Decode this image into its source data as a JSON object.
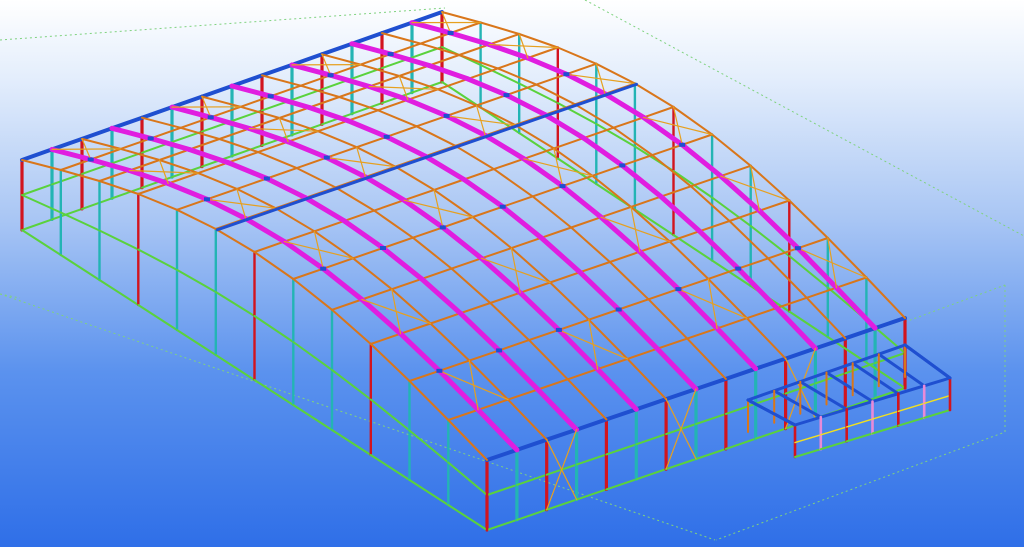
{
  "viewport": {
    "type": "3d-steel-structure-model",
    "colors": {
      "background_top": "#ffffff",
      "background_bottom": "#2f6fe8",
      "grid": "#7fd27f",
      "rafter_edge": "#1f4fd0",
      "column": "#d2141e",
      "purlin": "#d9761a",
      "eave_strut": "#5ad23c",
      "bracing": "#e6a020",
      "frame_rafter": "#e01ee0",
      "post": "#23b4b4",
      "secondary": "#e88ad8",
      "tie": "#f0e020"
    }
  }
}
